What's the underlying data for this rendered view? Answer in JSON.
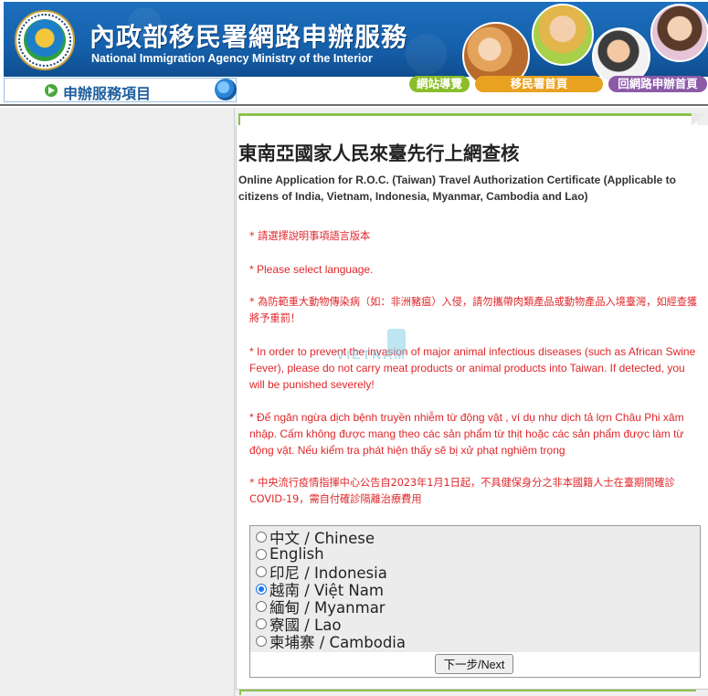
{
  "header": {
    "title_zh": "內政部移民署網路申辦服務",
    "title_en": "National Immigration Agency Ministry of the Interior",
    "nav": {
      "sitemap": "網站導覽",
      "immigration_home": "移民署首頁",
      "online_home": "回網路申辦首頁"
    },
    "subbar_label": "申辦服務項目",
    "icons": {
      "logo": "agency-seal-icon",
      "subbar": "arrow-circle-icon",
      "globe": "globe-icon"
    }
  },
  "main": {
    "title": "東南亞國家人民來臺先行上網查核",
    "subtitle": "Online Application for R.O.C. (Taiwan) Travel Authorization Certificate (Applicable to citizens of India, Vietnam, Indonesia, Myanmar, Cambodia and Lao)",
    "notices": [
      "* 請選擇說明事項語言版本",
      "* Please select language.",
      "* 為防範重大動物傳染病（如：非洲豬瘟）入侵，請勿攜帶肉類產品或動物產品入境臺灣，如經查獲將予重罰！",
      "* In order to prevent the invasion of major animal infectious diseases (such as African Swine Fever), please do not carry meat products or animal products into Taiwan. If detected, you will be punished severely!",
      "* Để ngăn ngừa dịch bệnh truyền nhiễm từ động vật , ví dụ như dịch tả lợn Châu Phi xâm nhập. Cấm không được mang theo các sản phẩm từ thịt hoặc các sản phẩm được làm từ động vật. Nếu kiểm tra phát hiện thấy sẽ bị xử phạt nghiêm trọng",
      "* 中央流行疫情指揮中心公告自2023年1月1日起，不具健保身分之非本國籍人士在臺期間確診COVID-19，需自付確診隔離治療費用"
    ],
    "languages": [
      {
        "label": "中文 / Chinese",
        "selected": false
      },
      {
        "label": "English",
        "selected": false
      },
      {
        "label": "印尼 / Indonesia",
        "selected": false
      },
      {
        "label": "越南 / Việt Nam",
        "selected": true
      },
      {
        "label": "緬甸 / Myanmar",
        "selected": false
      },
      {
        "label": "寮國 / Lao",
        "selected": false
      },
      {
        "label": "柬埔寨 / Cambodia",
        "selected": false
      }
    ],
    "next_label": "下一步/Next"
  },
  "watermark": {
    "text": "VIETNAM"
  },
  "colors": {
    "banner_blue": "#1660ab",
    "notice_red": "#e0262a",
    "accent_green": "#8bc34a",
    "nav_green": "#8bbd2a",
    "nav_orange": "#e9a21f",
    "nav_purple": "#8d5aa8"
  }
}
